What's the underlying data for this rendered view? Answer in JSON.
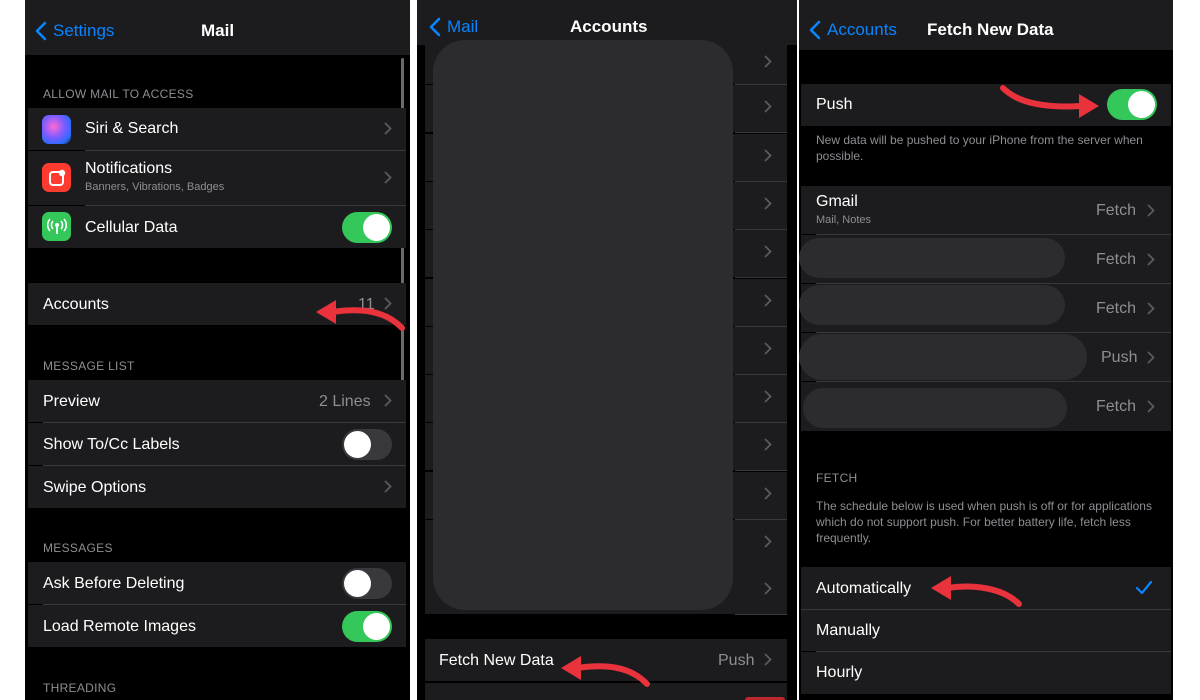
{
  "mail": {
    "back_label": "Settings",
    "title": "Mail",
    "allow_header": "ALLOW MAIL TO ACCESS",
    "siri_label": "Siri & Search",
    "notifications_label": "Notifications",
    "notifications_sub": "Banners, Vibrations, Badges",
    "cellular_label": "Cellular Data",
    "accounts_label": "Accounts",
    "accounts_count": "11",
    "message_list_header": "MESSAGE LIST",
    "preview_label": "Preview",
    "preview_value": "2 Lines",
    "show_tocc_label": "Show To/Cc Labels",
    "swipe_label": "Swipe Options",
    "messages_header": "MESSAGES",
    "ask_delete_label": "Ask Before Deleting",
    "load_images_label": "Load Remote Images",
    "threading_header": "THREADING",
    "toggles": {
      "cellular": true,
      "show_tocc": false,
      "ask_delete": false,
      "load_images": true
    }
  },
  "accounts": {
    "back_label": "Mail",
    "title": "Accounts",
    "fetch_label": "Fetch New Data",
    "fetch_value": "Push"
  },
  "fetch": {
    "back_label": "Accounts",
    "title": "Fetch New Data",
    "push_label": "Push",
    "push_on": true,
    "push_footer": "New data will be pushed to your iPhone from the server when possible.",
    "gmail_label": "Gmail",
    "gmail_sub": "Mail, Notes",
    "account_values": [
      "Fetch",
      "Fetch",
      "Fetch",
      "Push",
      "Fetch"
    ],
    "fetch_header": "FETCH",
    "fetch_footer": "The schedule below is used when push is off or for applications which do not support push. For better battery life, fetch less frequently.",
    "schedule_options": [
      "Automatically",
      "Manually",
      "Hourly"
    ],
    "selected_option": "Automatically"
  },
  "colors": {
    "accent": "#0a84ff",
    "toggle_on": "#34c759",
    "arrow": "#e8323c",
    "cell_bg": "#1c1c1e"
  }
}
